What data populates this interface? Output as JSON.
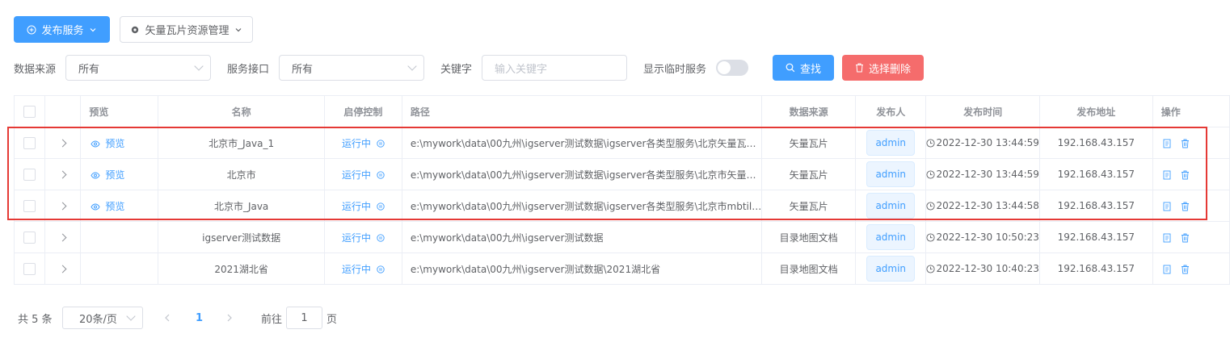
{
  "toolbar": {
    "publish_label": "发布服务",
    "tile_manage_label": "矢量瓦片资源管理"
  },
  "filters": {
    "source_label": "数据来源",
    "source_value": "所有",
    "interface_label": "服务接口",
    "interface_value": "所有",
    "keyword_label": "关键字",
    "keyword_placeholder": "输入关键字",
    "temp_label": "显示临时服务",
    "search_label": "查找",
    "delete_label": "选择删除"
  },
  "table": {
    "headers": {
      "preview": "预览",
      "name": "名称",
      "control": "启停控制",
      "path": "路径",
      "source": "数据来源",
      "publisher": "发布人",
      "time": "发布时间",
      "address": "发布地址",
      "ops": "操作"
    },
    "rows": [
      {
        "preview": "预览",
        "name": "北京市_Java_1",
        "status": "运行中",
        "path": "e:\\mywork\\data\\00九州\\igserver测试数据\\igserver各类型服务\\北京矢量瓦…",
        "source": "矢量瓦片",
        "publisher": "admin",
        "time": "2022-12-30 13:44:59",
        "address": "192.168.43.157"
      },
      {
        "preview": "预览",
        "name": "北京市",
        "status": "运行中",
        "path": "e:\\mywork\\data\\00九州\\igserver测试数据\\igserver各类型服务\\北京市矢量…",
        "source": "矢量瓦片",
        "publisher": "admin",
        "time": "2022-12-30 13:44:59",
        "address": "192.168.43.157"
      },
      {
        "preview": "预览",
        "name": "北京市_Java",
        "status": "运行中",
        "path": "e:\\mywork\\data\\00九州\\igserver测试数据\\igserver各类型服务\\北京市mbtil…",
        "source": "矢量瓦片",
        "publisher": "admin",
        "time": "2022-12-30 13:44:58",
        "address": "192.168.43.157"
      },
      {
        "preview": "",
        "name": "igserver测试数据",
        "status": "运行中",
        "path": "e:\\mywork\\data\\00九州\\igserver测试数据",
        "source": "目录地图文档",
        "publisher": "admin",
        "time": "2022-12-30 10:50:23",
        "address": "192.168.43.157"
      },
      {
        "preview": "",
        "name": "2021湖北省",
        "status": "运行中",
        "path": "e:\\mywork\\data\\00九州\\igserver测试数据\\2021湖北省",
        "source": "目录地图文档",
        "publisher": "admin",
        "time": "2022-12-30 10:40:23",
        "address": "192.168.43.157"
      }
    ]
  },
  "pager": {
    "total": "共 5 条",
    "page_size": "20条/页",
    "current_page": "1",
    "goto_label": "前往",
    "goto_value": "1",
    "page_unit": "页"
  }
}
